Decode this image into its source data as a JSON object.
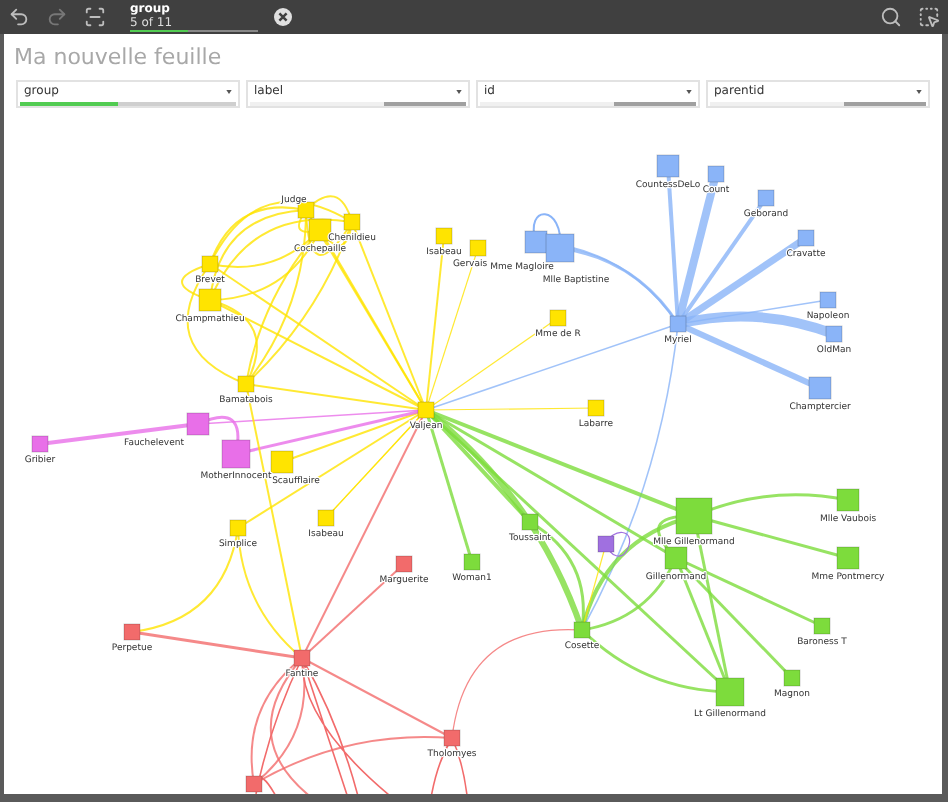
{
  "toolbar": {
    "selection": {
      "field": "group",
      "count": "5 of 11",
      "level": 0.45
    }
  },
  "sheet": {
    "title": "Ma nouvelle feuille"
  },
  "filters": [
    {
      "label": "group",
      "level": 0.45
    },
    {
      "label": "label",
      "level": 0
    },
    {
      "label": "id",
      "level": 0
    },
    {
      "label": "parentid",
      "level": 0
    }
  ],
  "nodes": [
    {
      "label": "Valjean",
      "color": "#ffe400"
    },
    {
      "label": "Judge",
      "color": "#ffe400"
    },
    {
      "label": "Cochepaille",
      "color": "#ffe400"
    },
    {
      "label": "Chenildieu",
      "color": "#ffe400"
    },
    {
      "label": "Brevet",
      "color": "#ffe400"
    },
    {
      "label": "Champmathieu",
      "color": "#ffe400"
    },
    {
      "label": "Bamatabois",
      "color": "#ffe400"
    },
    {
      "label": "Isabeau",
      "color": "#ffe400"
    },
    {
      "label": "Gervais",
      "color": "#ffe400"
    },
    {
      "label": "Mme de R",
      "color": "#ffe400"
    },
    {
      "label": "Labarre",
      "color": "#ffe400"
    },
    {
      "label": "Scaufflaire",
      "color": "#ffe400"
    },
    {
      "label": "Simplice",
      "color": "#ffe400"
    },
    {
      "label": "Isabeau",
      "color": "#ffe400"
    },
    {
      "label": "Mme Magloire",
      "color": "#8ab4f8"
    },
    {
      "label": "Mlle Baptistine",
      "color": "#8ab4f8"
    },
    {
      "label": "CountessDeLo",
      "color": "#8ab4f8"
    },
    {
      "label": "Count",
      "color": "#8ab4f8"
    },
    {
      "label": "Geborand",
      "color": "#8ab4f8"
    },
    {
      "label": "Cravatte",
      "color": "#8ab4f8"
    },
    {
      "label": "Napoleon",
      "color": "#8ab4f8"
    },
    {
      "label": "OldMan",
      "color": "#8ab4f8"
    },
    {
      "label": "Champtercier",
      "color": "#8ab4f8"
    },
    {
      "label": "Myriel",
      "color": "#8ab4f8"
    },
    {
      "label": "Gribier",
      "color": "#e86fe8"
    },
    {
      "label": "Fauchelevent",
      "color": "#e86fe8"
    },
    {
      "label": "MotherInnocent",
      "color": "#e86fe8"
    },
    {
      "label": "Perpetue",
      "color": "#f26b6b"
    },
    {
      "label": "Fantine",
      "color": "#f26b6b"
    },
    {
      "label": "Marguerite",
      "color": "#f26b6b"
    },
    {
      "label": "Woman1",
      "color": "#7ddc3c"
    },
    {
      "color": "#f26b6b"
    },
    {
      "label": "Tholomyes",
      "color": "#f26b6b"
    },
    {
      "label": "Toussaint",
      "color": "#7ddc3c"
    },
    {
      "color": "#a070e0"
    },
    {
      "label": "Cosette",
      "color": "#7ddc3c"
    },
    {
      "label": "Mlle Gillenormand",
      "color": "#7ddc3c"
    },
    {
      "label": "Gillenormand",
      "color": "#7ddc3c"
    },
    {
      "label": "Mlle Vaubois",
      "color": "#7ddc3c"
    },
    {
      "label": "Mme Pontmercy",
      "color": "#7ddc3c"
    },
    {
      "label": "Baroness T",
      "color": "#7ddc3c"
    },
    {
      "label": "Magnon",
      "color": "#7ddc3c"
    },
    {
      "label": "Lt Gillenormand",
      "color": "#7ddc3c"
    }
  ]
}
